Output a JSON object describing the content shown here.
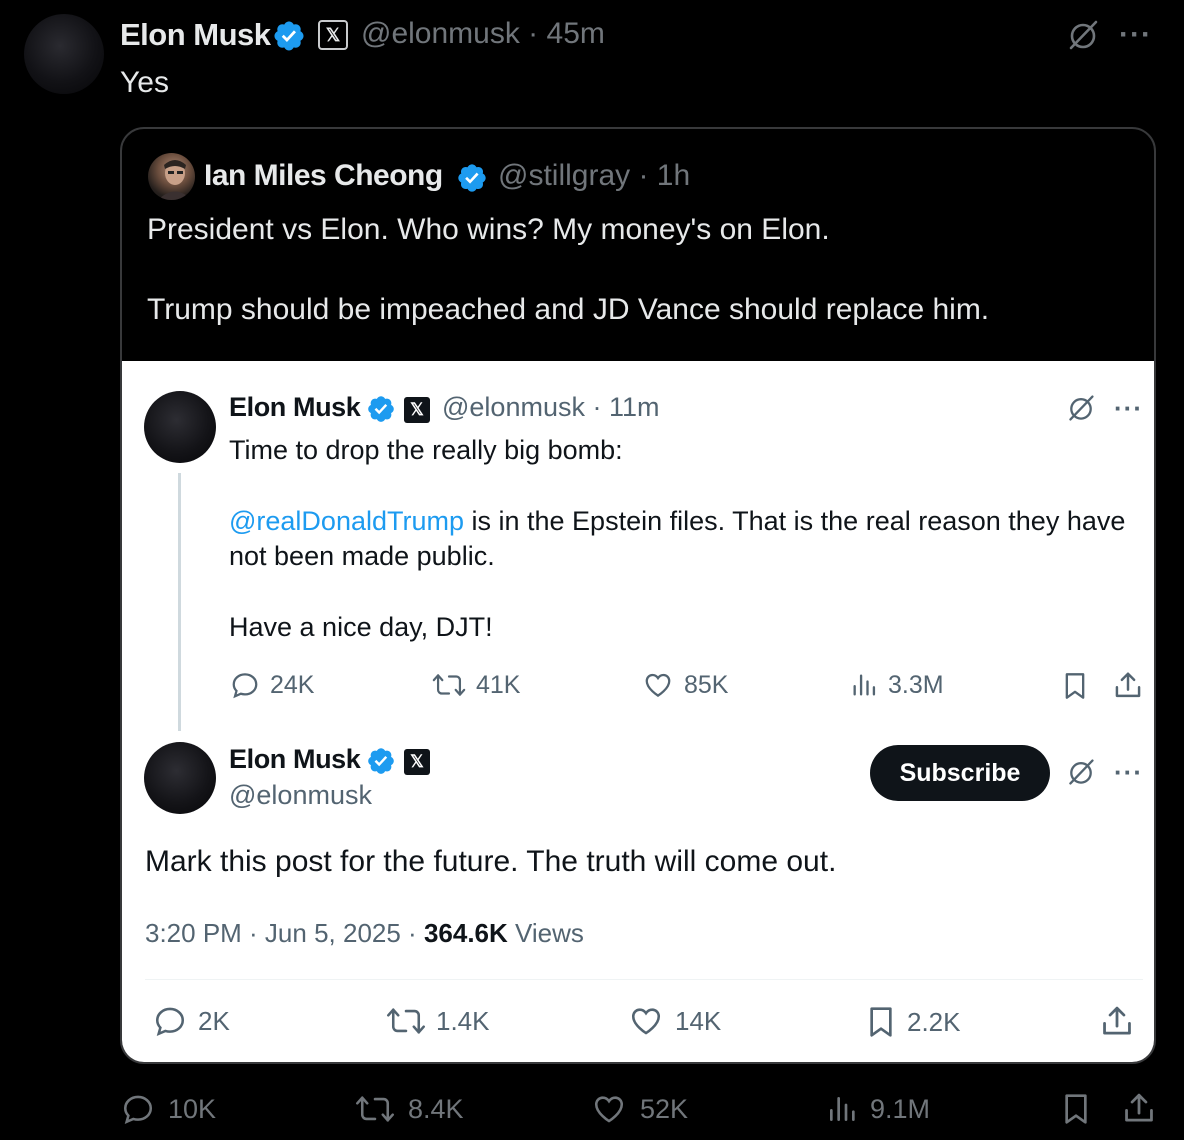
{
  "outer": {
    "name": "Elon Musk",
    "x_badge": "𝕏",
    "handle_time": "@elonmusk · 45m",
    "text": "Yes",
    "more": "···",
    "metrics": {
      "replies": "10K",
      "reposts": "8.4K",
      "likes": "52K",
      "views": "9.1M"
    }
  },
  "quote": {
    "name": "Ian Miles Cheong",
    "handle_time": "@stillgray · 1h",
    "text1": "President vs Elon. Who wins? My money's on Elon.",
    "text2": "Trump should be impeached and JD Vance should replace him."
  },
  "screenshot": {
    "first_post": {
      "name": "Elon Musk",
      "x_badge": "𝕏",
      "handle_time": "@elonmusk · 11m",
      "line1": "Time to drop the really big bomb:",
      "mention": "@realDonaldTrump",
      "line2_rest": " is in the Epstein files. That is the real reason they have",
      "line3": "not been made public.",
      "line4": "Have a nice day, DJT!",
      "more": "···",
      "metrics": {
        "replies": "24K",
        "reposts": "41K",
        "likes": "85K",
        "views": "3.3M"
      }
    },
    "second_post": {
      "name": "Elon Musk",
      "x_badge": "𝕏",
      "handle": "@elonmusk",
      "subscribe_label": "Subscribe",
      "more": "···",
      "text": "Mark this post for the future. The truth will come out.",
      "time": "3:20 PM · Jun 5, 2025 · ",
      "views_count": "364.6K",
      "views_label": " Views",
      "metrics": {
        "replies": "2K",
        "reposts": "1.4K",
        "likes": "14K",
        "bookmarks": "2.2K"
      }
    }
  },
  "colors": {
    "background": "#000000",
    "verified": "#1d9bf0",
    "link": "#1d9bf0",
    "muted_dark": "#71767b",
    "muted_light": "#536471"
  }
}
